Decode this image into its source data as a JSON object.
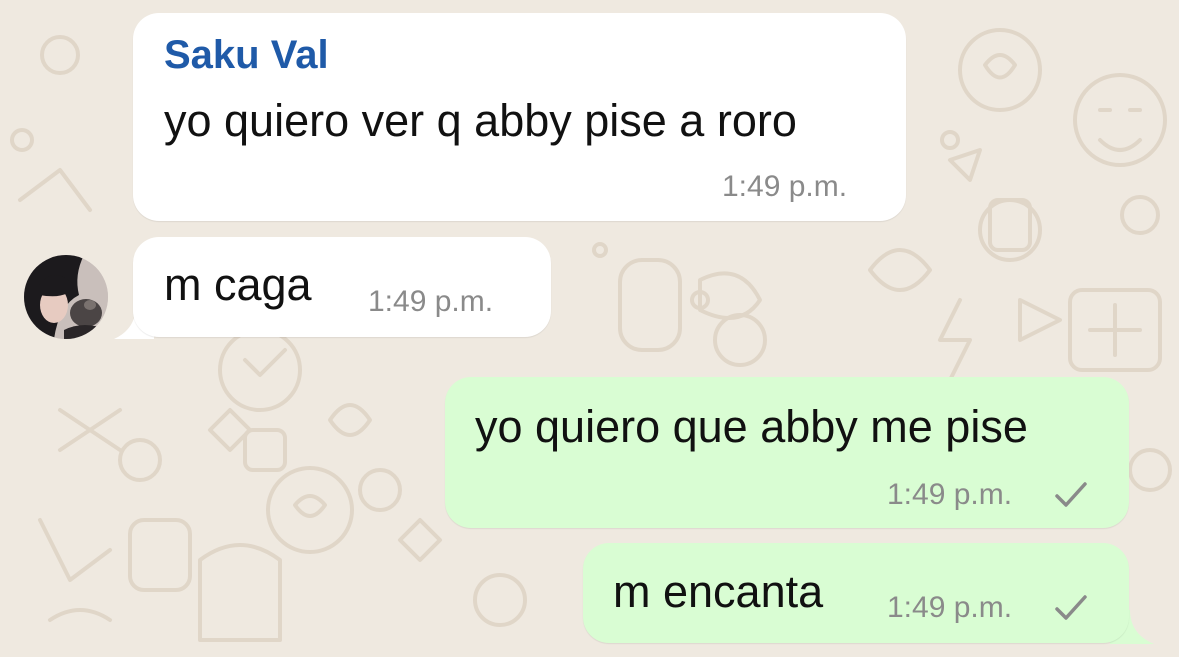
{
  "chat": {
    "wallpaper": {
      "background_color": "#efe9e0",
      "doodle_color": "#e0d6c8"
    },
    "colors": {
      "incoming_bubble": "#ffffff",
      "outgoing_bubble": "#d9fdd3",
      "sender_name": "#1f5aa8",
      "timestamp": "#8a8a8a"
    },
    "messages": [
      {
        "direction": "incoming",
        "sender": "Saku Val",
        "text": "yo quiero ver q abby pise a roro",
        "time": "1:49 p.m."
      },
      {
        "direction": "incoming",
        "text": "m caga",
        "time": "1:49 p.m.",
        "avatar": "user-avatar"
      },
      {
        "direction": "outgoing",
        "text": "yo quiero que abby me pise",
        "time": "1:49 p.m.",
        "status_icon": "single-check-icon"
      },
      {
        "direction": "outgoing",
        "text": "m encanta",
        "time": "1:49 p.m.",
        "status_icon": "single-check-icon"
      }
    ]
  }
}
